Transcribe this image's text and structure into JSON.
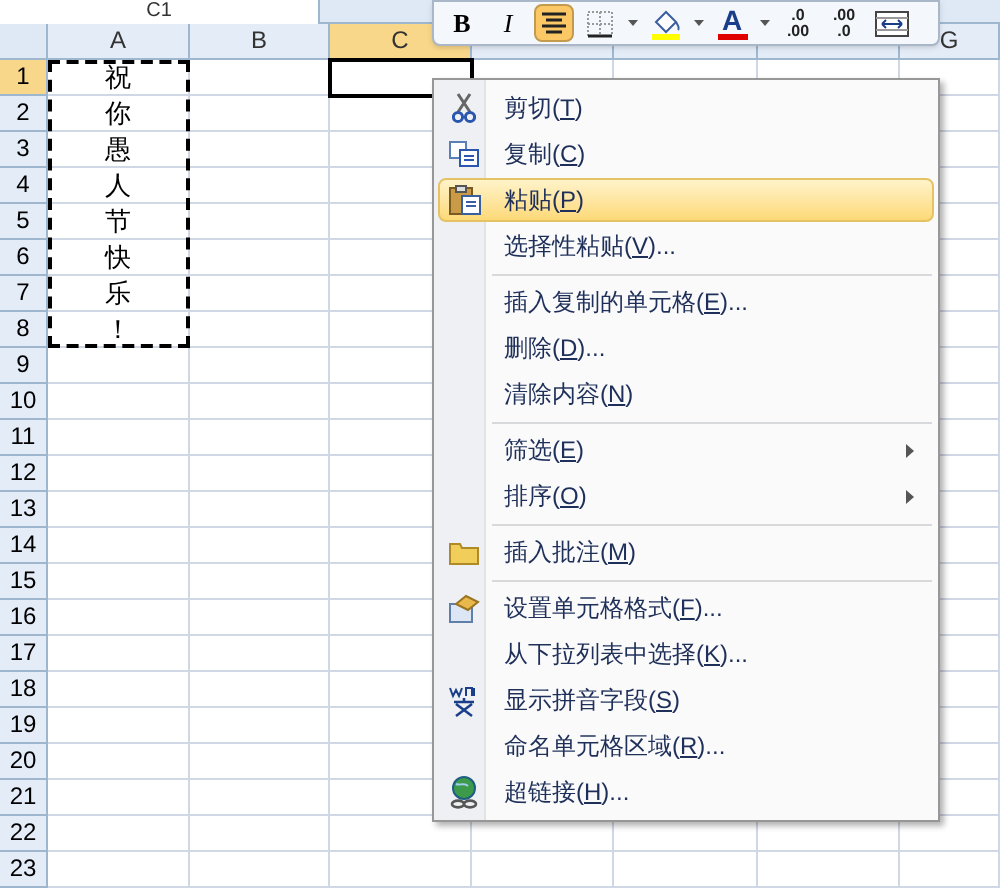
{
  "name_box": {
    "value": "C1"
  },
  "mini_toolbar": [
    {
      "kind": "bold",
      "label": "B",
      "selected": false
    },
    {
      "kind": "italic",
      "label": "I",
      "selected": false
    },
    {
      "kind": "align-center",
      "selected": true
    },
    {
      "kind": "borders",
      "selected": false
    },
    {
      "kind": "dropdown",
      "selected": false
    },
    {
      "kind": "fill-color",
      "selected": false
    },
    {
      "kind": "dropdown",
      "selected": false
    },
    {
      "kind": "font-color",
      "label": "A",
      "selected": false
    },
    {
      "kind": "dropdown",
      "selected": false
    },
    {
      "kind": "increase-decimal",
      "top": ".0",
      "bottom": ".00",
      "selected": false
    },
    {
      "kind": "decrease-decimal",
      "top": ".00",
      "bottom": ".0",
      "selected": false
    },
    {
      "kind": "merge",
      "selected": false
    }
  ],
  "columns": [
    {
      "label": "A",
      "selected": false
    },
    {
      "label": "B",
      "selected": false
    },
    {
      "label": "C",
      "selected": true
    },
    {
      "selected": false
    },
    {
      "selected": false
    },
    {
      "selected": false
    },
    {
      "label": "G",
      "selected": false
    }
  ],
  "rows": [
    {
      "label": "1",
      "selected": true,
      "copied": true,
      "cells": [
        "祝",
        "",
        "",
        "",
        "",
        "",
        ""
      ]
    },
    {
      "label": "2",
      "selected": false,
      "copied": true,
      "cells": [
        "你",
        "",
        "",
        "",
        "",
        "",
        ""
      ]
    },
    {
      "label": "3",
      "selected": false,
      "copied": true,
      "cells": [
        "愚",
        "",
        "",
        "",
        "",
        "",
        ""
      ]
    },
    {
      "label": "4",
      "selected": false,
      "copied": true,
      "cells": [
        "人",
        "",
        "",
        "",
        "",
        "",
        ""
      ]
    },
    {
      "label": "5",
      "selected": false,
      "copied": true,
      "cells": [
        "节",
        "",
        "",
        "",
        "",
        "",
        ""
      ]
    },
    {
      "label": "6",
      "selected": false,
      "copied": true,
      "cells": [
        "快",
        "",
        "",
        "",
        "",
        "",
        ""
      ]
    },
    {
      "label": "7",
      "selected": false,
      "copied": true,
      "cells": [
        "乐",
        "",
        "",
        "",
        "",
        "",
        ""
      ]
    },
    {
      "label": "8",
      "selected": false,
      "copied": true,
      "cells": [
        "！",
        "",
        "",
        "",
        "",
        "",
        ""
      ]
    },
    {
      "label": "9",
      "selected": false,
      "copied": false,
      "cells": []
    },
    {
      "label": "10",
      "selected": false,
      "copied": false,
      "cells": []
    },
    {
      "label": "11",
      "selected": false,
      "copied": false,
      "cells": []
    },
    {
      "label": "12",
      "selected": false,
      "copied": false,
      "cells": []
    },
    {
      "label": "13",
      "selected": false,
      "copied": false,
      "cells": []
    },
    {
      "label": "14",
      "selected": false,
      "copied": false,
      "cells": []
    },
    {
      "label": "15",
      "selected": false,
      "copied": false,
      "cells": []
    },
    {
      "label": "16",
      "selected": false,
      "copied": false,
      "cells": []
    },
    {
      "label": "17",
      "selected": false,
      "copied": false,
      "cells": []
    },
    {
      "label": "18",
      "selected": false,
      "copied": false,
      "cells": []
    },
    {
      "label": "19",
      "selected": false,
      "copied": false,
      "cells": []
    },
    {
      "label": "20",
      "selected": false,
      "copied": false,
      "cells": []
    },
    {
      "label": "21",
      "selected": false,
      "copied": false,
      "cells": []
    },
    {
      "label": "22",
      "selected": false,
      "copied": false,
      "cells": []
    },
    {
      "label": "23",
      "selected": false,
      "copied": false,
      "cells": []
    }
  ],
  "context_menu": [
    {
      "kind": "cut",
      "before": "剪切(",
      "key": "T",
      "after": ")",
      "selected": false,
      "separator_before": false,
      "submenu": false
    },
    {
      "kind": "copy",
      "before": "复制(",
      "key": "C",
      "after": ")",
      "selected": false,
      "separator_before": false,
      "submenu": false
    },
    {
      "kind": "paste",
      "before": "粘贴(",
      "key": "P",
      "after": ")",
      "selected": true,
      "separator_before": false,
      "submenu": false
    },
    {
      "kind": "plain",
      "before": "选择性粘贴(",
      "key": "V",
      "after": ")...",
      "selected": false,
      "separator_before": false,
      "submenu": false
    },
    {
      "kind": "plain",
      "before": "插入复制的单元格(",
      "key": "E",
      "after": ")...",
      "selected": false,
      "separator_before": true,
      "submenu": false
    },
    {
      "kind": "plain",
      "before": "删除(",
      "key": "D",
      "after": ")...",
      "selected": false,
      "separator_before": false,
      "submenu": false
    },
    {
      "kind": "plain",
      "before": "清除内容(",
      "key": "N",
      "after": ")",
      "selected": false,
      "separator_before": false,
      "submenu": false
    },
    {
      "kind": "plain",
      "before": "筛选(",
      "key": "E",
      "after": ")",
      "selected": false,
      "separator_before": true,
      "submenu": true
    },
    {
      "kind": "plain",
      "before": "排序(",
      "key": "O",
      "after": ")",
      "selected": false,
      "separator_before": false,
      "submenu": true
    },
    {
      "kind": "comment",
      "before": "插入批注(",
      "key": "M",
      "after": ")",
      "selected": false,
      "separator_before": true,
      "submenu": false
    },
    {
      "kind": "format",
      "before": "设置单元格格式(",
      "key": "F",
      "after": ")...",
      "selected": false,
      "separator_before": true,
      "submenu": false
    },
    {
      "kind": "plain",
      "before": "从下拉列表中选择(",
      "key": "K",
      "after": ")...",
      "selected": false,
      "separator_before": false,
      "submenu": false
    },
    {
      "kind": "pinyin",
      "before": "显示拼音字段(",
      "key": "S",
      "after": ")",
      "selected": false,
      "separator_before": false,
      "submenu": false
    },
    {
      "kind": "plain",
      "before": "命名单元格区域(",
      "key": "R",
      "after": ")...",
      "selected": false,
      "separator_before": false,
      "submenu": false
    },
    {
      "kind": "hyperlink",
      "before": "超链接(",
      "key": "H",
      "after": ")...",
      "selected": false,
      "separator_before": false,
      "submenu": false
    }
  ]
}
